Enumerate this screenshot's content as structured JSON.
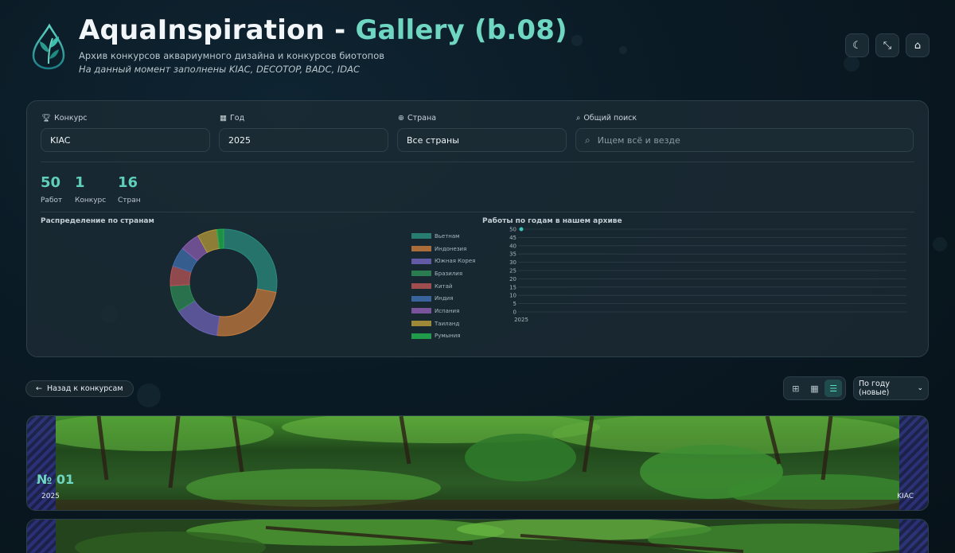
{
  "header": {
    "title_main": "AquaInspiration - ",
    "title_accent": "Gallery (b.08)",
    "subtitle": "Архив конкурсов аквариумного дизайна и конкурсов биотопов",
    "subtitle_note": "На данный момент заполнены KIAC, DECOTOP, BADC, IDAC",
    "buttons": [
      {
        "icon": "moon-icon",
        "glyph": "☾"
      },
      {
        "icon": "compress-icon",
        "glyph": "⤡"
      },
      {
        "icon": "home-icon",
        "glyph": "⌂"
      }
    ]
  },
  "filters": {
    "contest": {
      "label": "Конкурс",
      "value": "KIAC"
    },
    "year": {
      "label": "Год",
      "value": "2025"
    },
    "country": {
      "label": "Страна",
      "value": "Все страны"
    },
    "search": {
      "label": "Общий поиск",
      "placeholder": "Ищем всё и везде"
    }
  },
  "stats": [
    {
      "value": "50",
      "label": "Работ"
    },
    {
      "value": "1",
      "label": "Конкурс"
    },
    {
      "value": "16",
      "label": "Стран"
    }
  ],
  "charts_titles": {
    "donut": "Распределение по странам",
    "line": "Работы по годам в нашем архиве"
  },
  "chart_data": [
    {
      "type": "pie",
      "title": "Распределение по странам",
      "legend_position": "right",
      "series": [
        {
          "name": "Вьетнам",
          "value": 14,
          "color": "#2a8c7e"
        },
        {
          "name": "Индонезия",
          "value": 12,
          "color": "#c47a3c"
        },
        {
          "name": "Южная Корея",
          "value": 7,
          "color": "#6f63b8"
        },
        {
          "name": "Бразилия",
          "value": 4,
          "color": "#2e8a55"
        },
        {
          "name": "Китай",
          "value": 3,
          "color": "#b85456"
        },
        {
          "name": "Индия",
          "value": 3,
          "color": "#3f6fae"
        },
        {
          "name": "Испания",
          "value": 3,
          "color": "#8a5cb0"
        },
        {
          "name": "Таиланд",
          "value": 3,
          "color": "#b59a3a"
        },
        {
          "name": "Румыния",
          "value": 1,
          "color": "#21b04e"
        }
      ]
    },
    {
      "type": "line",
      "title": "Работы по годам в нашем архиве",
      "x": [
        "2025"
      ],
      "y": [
        50
      ],
      "ylim": [
        0,
        50
      ],
      "yticks": [
        0,
        5,
        10,
        15,
        20,
        25,
        30,
        35,
        40,
        45,
        50
      ],
      "grid": true,
      "color": "#3bc7c0"
    }
  ],
  "toolbar": {
    "back_label": "Назад к конкурсам",
    "sort_value": "По году (новые)",
    "views": [
      {
        "icon": "grid-large-icon",
        "glyph": "⊞",
        "active": false
      },
      {
        "icon": "grid-small-icon",
        "glyph": "▦",
        "active": false
      },
      {
        "icon": "list-icon",
        "glyph": "☰",
        "active": true
      }
    ]
  },
  "cards": [
    {
      "number": "№ 01",
      "year": "2025",
      "contest": "KIAC"
    },
    {
      "number": "",
      "year": "",
      "contest": ""
    }
  ]
}
